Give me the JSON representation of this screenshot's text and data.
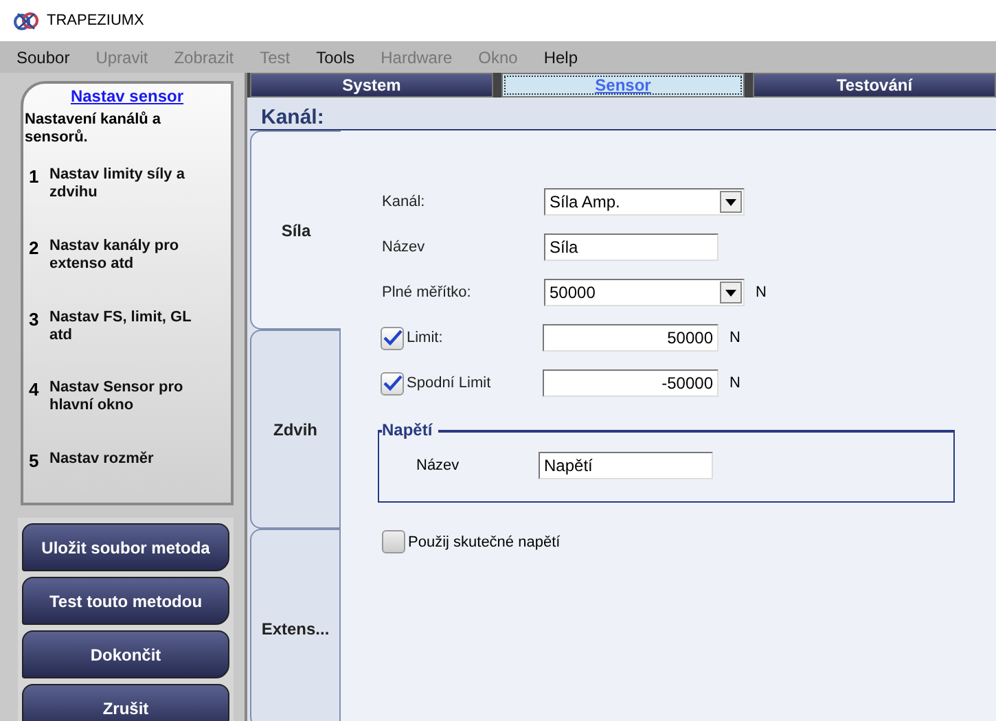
{
  "window": {
    "title": "TRAPEZIUMX"
  },
  "menu": [
    {
      "label": "Soubor",
      "disabled": false
    },
    {
      "label": "Upravit",
      "disabled": true
    },
    {
      "label": "Zobrazit",
      "disabled": true
    },
    {
      "label": "Test",
      "disabled": true
    },
    {
      "label": "Tools",
      "disabled": false
    },
    {
      "label": "Hardware",
      "disabled": true
    },
    {
      "label": "Okno",
      "disabled": true
    },
    {
      "label": "Help",
      "disabled": false
    }
  ],
  "guide": {
    "title": "Nastav sensor",
    "description": "Nastavení kanálů a sensorů.",
    "steps": [
      {
        "number": "1",
        "text": "Nastav limity síly a zdvihu"
      },
      {
        "number": "2",
        "text": "Nastav kanály pro extenso atd"
      },
      {
        "number": "3",
        "text": "Nastav FS, limit, GL atd"
      },
      {
        "number": "4",
        "text": "Nastav  Sensor pro hlavní okno"
      },
      {
        "number": "5",
        "text": "Nastav rozměr"
      }
    ]
  },
  "actions": [
    "Uložit soubor metoda",
    "Test touto metodou",
    "Dokončit",
    "Zrušit"
  ],
  "tabs": [
    {
      "label": "System",
      "selected": false
    },
    {
      "label": "Sensor",
      "selected": true
    },
    {
      "label": "Testování",
      "selected": false
    }
  ],
  "section_title": "Kanál:",
  "side_tabs": [
    {
      "label": "Síla",
      "selected": true
    },
    {
      "label": "Zdvih",
      "selected": false
    },
    {
      "label": "Extens...",
      "selected": false
    }
  ],
  "fields": [
    {
      "kind": "select",
      "label": "Kanál:",
      "value": "Síla Amp."
    },
    {
      "kind": "text",
      "label": "Název",
      "value": "Síla"
    },
    {
      "kind": "select",
      "label": "Plné měřítko:",
      "value": "50000",
      "unit": "N"
    },
    {
      "kind": "check",
      "label": "Limit:",
      "checked": true,
      "value": "50000",
      "unit": "N"
    },
    {
      "kind": "check",
      "label": "Spodní Limit",
      "checked": true,
      "value": "-50000",
      "unit": "N"
    }
  ],
  "group": {
    "title": "Napětí",
    "label": "Název",
    "value": "Napětí"
  },
  "option": {
    "label": "Použij skutečné napětí",
    "checked": false
  }
}
